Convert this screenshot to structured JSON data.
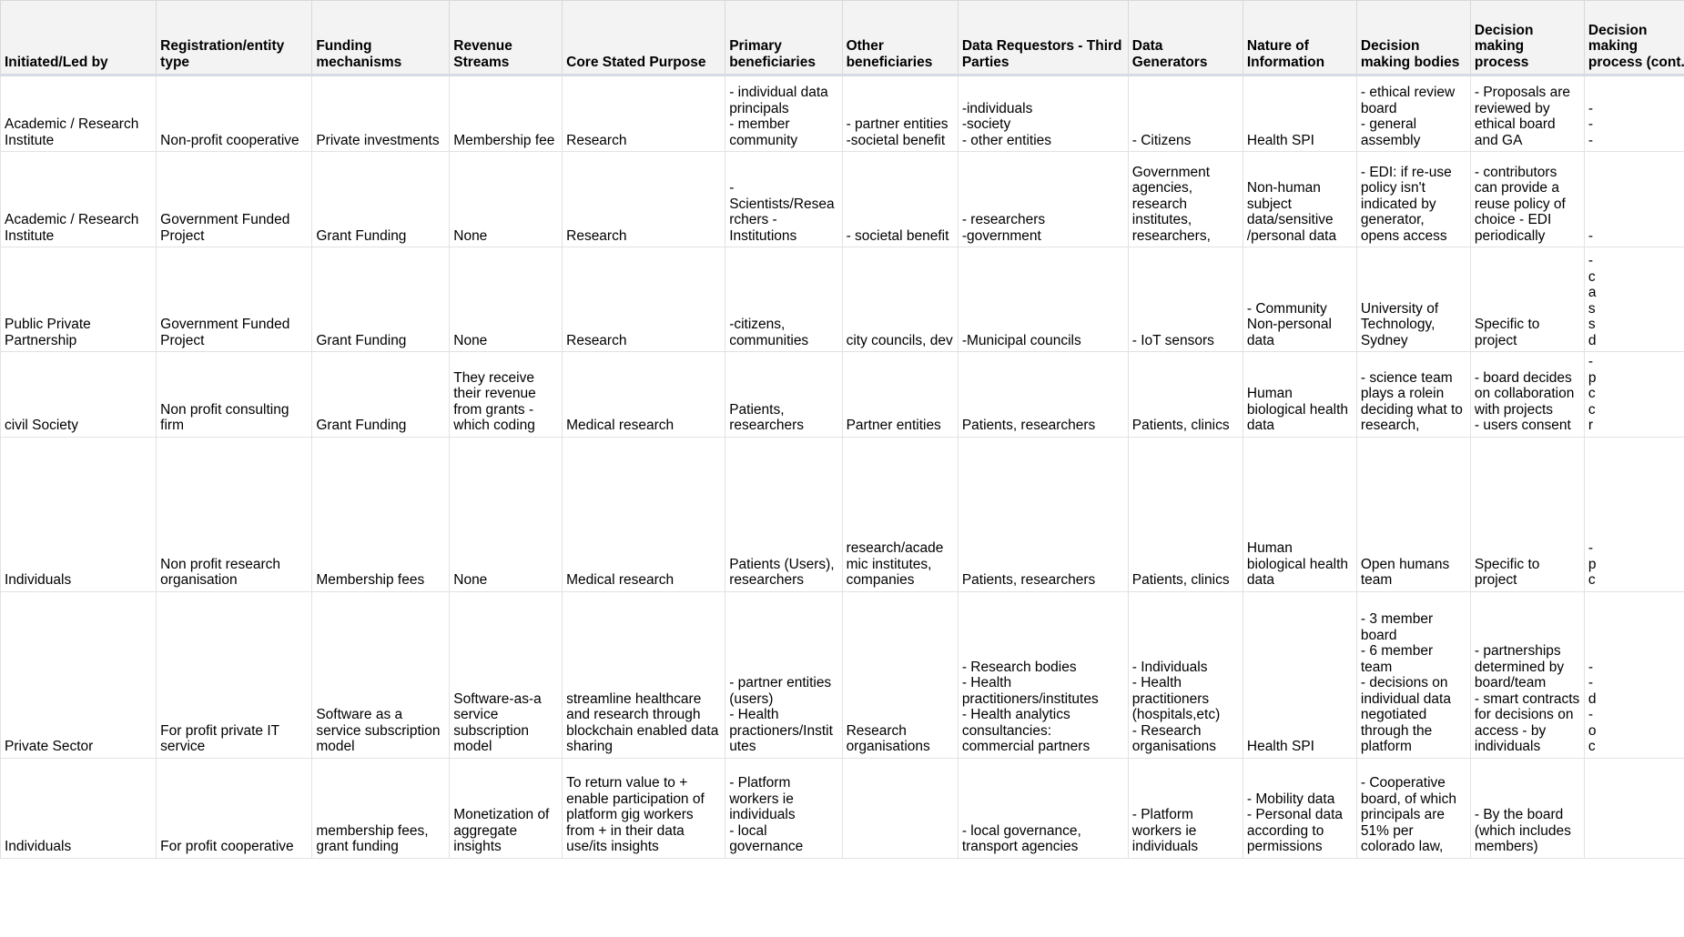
{
  "table": {
    "columns": [
      "Initiated/Led by",
      "Registration/entity type",
      "Funding mechanisms",
      "Revenue Streams",
      "Core Stated Purpose",
      "Primary beneficiaries",
      "Other beneficiaries",
      "Data Requestors - Third Parties",
      "Data Generators",
      "Nature of Information",
      "Decision making bodies",
      "Decision making process",
      "Decision making process (cont.)"
    ],
    "rows": [
      {
        "initiated_led_by": "Academic / Research Institute",
        "registration_entity_type": "Non-profit cooperative",
        "funding_mechanisms": "Private investments",
        "revenue_streams": "Membership fee",
        "core_stated_purpose": "Research",
        "primary_beneficiaries": "- individual data principals\n- member community",
        "other_beneficiaries": "- partner entities\n-societal benefit",
        "data_requestors_third_parties": "-individuals\n-society\n- other entities",
        "data_generators": "- Citizens",
        "nature_of_information": "Health SPI",
        "decision_making_bodies": "- ethical review board\n- general assembly",
        "decision_making_process": "- Proposals are reviewed by ethical board and GA",
        "overflow": "-\n-\n-"
      },
      {
        "initiated_led_by": "Academic / Research Institute",
        "registration_entity_type": "Government Funded Project",
        "funding_mechanisms": "Grant Funding",
        "revenue_streams": "None",
        "core_stated_purpose": "Research",
        "primary_beneficiaries": "-Scientists/Researchers - Institutions",
        "other_beneficiaries": "- societal benefit",
        "data_requestors_third_parties": "- researchers\n-government",
        "data_generators": "Government agencies, research institutes, researchers,",
        "nature_of_information": "Non-human subject data/sensitive /personal data",
        "decision_making_bodies": "- EDI: if re-use policy isn't indicated by generator, opens access",
        "decision_making_process": "- contributors can provide a reuse policy of choice - EDI periodically",
        "overflow": "-"
      },
      {
        "initiated_led_by": "Public Private Partnership",
        "registration_entity_type": "Government Funded Project",
        "funding_mechanisms": "Grant Funding",
        "revenue_streams": "None",
        "core_stated_purpose": "Research",
        "primary_beneficiaries": "-citizens, communities",
        "other_beneficiaries": "city councils, dev",
        "data_requestors_third_parties": "-Municipal councils",
        "data_generators": "- IoT sensors",
        "nature_of_information": "- Community Non-personal data",
        "decision_making_bodies": "University of Technology, Sydney",
        "decision_making_process": "Specific to project",
        "overflow": "-\nc\na\ns\ns\nd"
      },
      {
        "initiated_led_by": "civil Society",
        "registration_entity_type": "Non profit consulting firm",
        "funding_mechanisms": "Grant Funding",
        "revenue_streams": "They receive their revenue from grants -which coding",
        "core_stated_purpose": "Medical research",
        "primary_beneficiaries": "Patients, researchers",
        "other_beneficiaries": "Partner entities",
        "data_requestors_third_parties": "Patients, researchers",
        "data_generators": "Patients, clinics",
        "nature_of_information": "Human biological health data",
        "decision_making_bodies": "- science team plays a rolein deciding what to research,",
        "decision_making_process": "- board decides on collaboration with projects\n- users consent",
        "overflow": "-\np\nc\nc\nr"
      },
      {
        "initiated_led_by": "Individuals",
        "registration_entity_type": "Non profit research organisation",
        "funding_mechanisms": "Membership fees",
        "revenue_streams": "None",
        "core_stated_purpose": "Medical research",
        "primary_beneficiaries": "Patients (Users), researchers",
        "other_beneficiaries": "research/academic institutes, companies",
        "data_requestors_third_parties": "Patients, researchers",
        "data_generators": "Patients, clinics",
        "nature_of_information": "Human biological health data",
        "decision_making_bodies": "Open humans team",
        "decision_making_process": "Specific to project",
        "overflow": "-\np\nc"
      },
      {
        "initiated_led_by": "Private Sector",
        "registration_entity_type": "For profit private IT service",
        "funding_mechanisms": "Software as a service subscription model",
        "revenue_streams": "Software-as-a service subscription model",
        "core_stated_purpose": "streamline healthcare and research through blockchain enabled data sharing",
        "primary_beneficiaries": "- partner entities (users)\n- Health practioners/Institutes",
        "other_beneficiaries": "Research organisations",
        "data_requestors_third_parties": "- Research bodies\n- Health practitioners/institutes\n- Health analytics consultancies: commercial partners",
        "data_generators": "- Individuals\n- Health practitioners (hospitals,etc)\n- Research organisations",
        "nature_of_information": "Health SPI",
        "decision_making_bodies": "- 3 member board\n- 6 member team\n- decisions on individual data negotiated through the platform",
        "decision_making_process": "- partnerships determined by board/team\n- smart contracts for decisions on access - by individuals",
        "overflow": "-\n-\nd\n-\no\nc"
      },
      {
        "initiated_led_by": "Individuals",
        "registration_entity_type": "For profit cooperative",
        "funding_mechanisms": "membership fees, grant funding",
        "revenue_streams": "Monetization of aggregate insights",
        "core_stated_purpose": "To return value to + enable participation of platform gig workers from + in their data use/its insights",
        "primary_beneficiaries": "- Platform workers ie individuals\n- local governance",
        "other_beneficiaries": "",
        "data_requestors_third_parties": "- local governance, transport agencies",
        "data_generators": "- Platform workers ie individuals",
        "nature_of_information": "- Mobility data\n- Personal data according to permissions",
        "decision_making_bodies": "- Cooperative board, of which principals are 51% per colorado law,",
        "decision_making_process": "- By the board (which includes members)",
        "overflow": ""
      }
    ]
  }
}
